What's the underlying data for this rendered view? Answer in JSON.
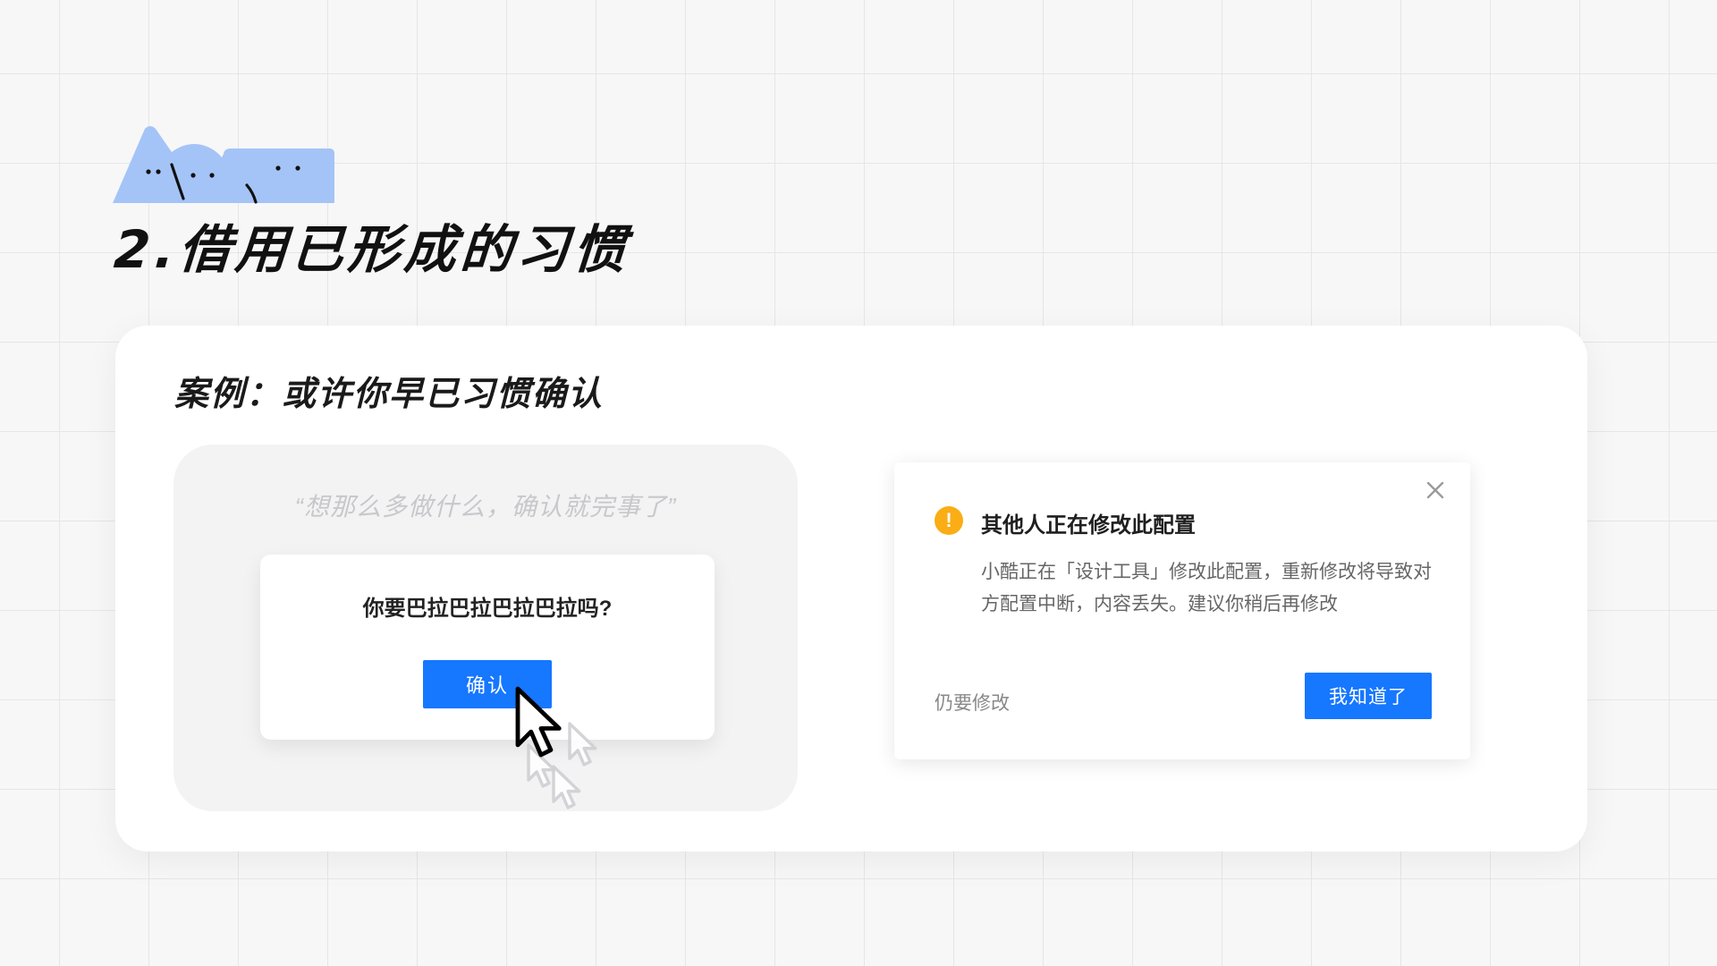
{
  "slide": {
    "title": "2.借用已形成的习惯"
  },
  "case": {
    "title": "案例：或许你早已习惯确认"
  },
  "demo": {
    "quote": "“想那么多做什么，确认就完事了”",
    "dialog": {
      "question": "你要巴拉巴拉巴拉巴拉吗?",
      "confirm_label": "确认"
    }
  },
  "notice": {
    "icon": "warning-icon",
    "title": "其他人正在修改此配置",
    "body": "小酷正在「设计工具」修改此配置，重新修改将导致对方配置中断，内容丢失。建议你稍后再修改",
    "secondary_label": "仍要修改",
    "primary_label": "我知道了",
    "close_icon": "close-icon"
  },
  "colors": {
    "accent": "#1677ff",
    "warning": "#faad14",
    "mascot": "#a4c4f7",
    "background": "#f7f7f8"
  }
}
